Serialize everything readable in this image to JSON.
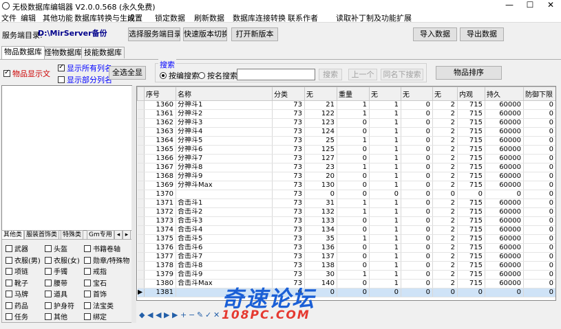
{
  "window": {
    "title": "无极数据库编辑器 V2.0.0.568 (永久免费)",
    "controls": [
      "—",
      "☐",
      "✕"
    ]
  },
  "menu": [
    "文件",
    "编辑",
    "其他功能",
    "数据库转换与生成",
    "设置",
    "锁定数据",
    "刷新数据",
    "数据库连接转换",
    "联系作者",
    "读取补丁制及功能扩展"
  ],
  "server": {
    "label": "服务端目录:",
    "path": "D:\\MirServer备份",
    "browse_btn": "选择服务端目录",
    "quick_switch_btn": "快速版本切换",
    "open_new_btn": "打开新版本"
  },
  "toolbar": {
    "import_btn": "导入数据",
    "export_btn": "导出数据"
  },
  "db_tabs": [
    "物品数据库",
    "怪物数据库",
    "技能数据库"
  ],
  "options": {
    "sync_text": "物品显示文",
    "show_all_cols": "显示所有列名",
    "show_spec_cols": "显示部分列名",
    "select_all_btn": "全选全显"
  },
  "search": {
    "group_label": "搜索",
    "mode_exact": "按编搜索",
    "mode_fuzzy": "按名搜索",
    "value": "",
    "search_btn": "搜索",
    "prev_btn": "上一个",
    "next_btn": "同名下搜索"
  },
  "sort_btn": "物品排序",
  "table": {
    "columns": [
      "序号",
      "名称",
      "分类",
      "无",
      "重量",
      "无",
      "无",
      "无",
      "内观",
      "持久",
      "防御下限"
    ],
    "rows": [
      [
        "1360",
        "分神斗1",
        "73",
        "21",
        "1",
        "1",
        "0",
        "2",
        "715",
        "60000",
        "0"
      ],
      [
        "1361",
        "分神斗2",
        "73",
        "122",
        "1",
        "1",
        "0",
        "2",
        "715",
        "60000",
        "0"
      ],
      [
        "1362",
        "分神斗3",
        "73",
        "123",
        "0",
        "1",
        "0",
        "2",
        "715",
        "60000",
        "0"
      ],
      [
        "1363",
        "分神斗4",
        "73",
        "124",
        "0",
        "1",
        "0",
        "2",
        "715",
        "60000",
        "0"
      ],
      [
        "1364",
        "分神斗5",
        "73",
        "25",
        "1",
        "1",
        "0",
        "2",
        "715",
        "60000",
        "0"
      ],
      [
        "1365",
        "分神斗6",
        "73",
        "125",
        "0",
        "1",
        "0",
        "2",
        "715",
        "60000",
        "0"
      ],
      [
        "1366",
        "分神斗7",
        "73",
        "127",
        "0",
        "1",
        "0",
        "2",
        "715",
        "60000",
        "0"
      ],
      [
        "1367",
        "分神斗8",
        "73",
        "23",
        "1",
        "1",
        "0",
        "2",
        "715",
        "60000",
        "0"
      ],
      [
        "1368",
        "分神斗9",
        "73",
        "20",
        "0",
        "1",
        "0",
        "2",
        "715",
        "60000",
        "0"
      ],
      [
        "1369",
        "分神斗Max",
        "73",
        "130",
        "0",
        "1",
        "0",
        "2",
        "715",
        "60000",
        "0"
      ],
      [
        "1370",
        "",
        "73",
        "0",
        "0",
        "0",
        "0",
        "0",
        "0",
        "0",
        "0"
      ],
      [
        "1371",
        "合击斗1",
        "73",
        "31",
        "1",
        "1",
        "0",
        "2",
        "715",
        "60000",
        "0"
      ],
      [
        "1372",
        "合击斗2",
        "73",
        "132",
        "1",
        "1",
        "0",
        "2",
        "715",
        "60000",
        "0"
      ],
      [
        "1373",
        "合击斗3",
        "73",
        "133",
        "0",
        "1",
        "0",
        "2",
        "715",
        "60000",
        "0"
      ],
      [
        "1374",
        "合击斗4",
        "73",
        "134",
        "0",
        "1",
        "0",
        "2",
        "715",
        "60000",
        "0"
      ],
      [
        "1375",
        "合击斗5",
        "73",
        "35",
        "1",
        "1",
        "0",
        "2",
        "715",
        "60000",
        "0"
      ],
      [
        "1376",
        "合击斗6",
        "73",
        "136",
        "0",
        "1",
        "0",
        "2",
        "715",
        "60000",
        "0"
      ],
      [
        "1377",
        "合击斗7",
        "73",
        "137",
        "0",
        "1",
        "0",
        "2",
        "715",
        "60000",
        "0"
      ],
      [
        "1378",
        "合击斗8",
        "73",
        "138",
        "0",
        "1",
        "0",
        "2",
        "715",
        "60000",
        "0"
      ],
      [
        "1379",
        "合击斗9",
        "73",
        "30",
        "1",
        "1",
        "0",
        "2",
        "715",
        "60000",
        "0"
      ],
      [
        "1380",
        "合击斗Max",
        "73",
        "140",
        "0",
        "1",
        "0",
        "2",
        "715",
        "60000",
        "0"
      ],
      [
        "1381",
        "",
        "0",
        "0",
        "0",
        "0",
        "0",
        "0",
        "0",
        "0",
        "0"
      ]
    ],
    "selected_index": 21
  },
  "category_tabs": [
    "其他类",
    "服装首饰类",
    "特殊类",
    "Gm专用"
  ],
  "category_checks": [
    [
      "武器",
      "头盔",
      "书籍卷轴"
    ],
    [
      "衣服(男)",
      "衣服(女)",
      "勋章/特殊物"
    ],
    [
      "项链",
      "手镯",
      "戒指"
    ],
    [
      "靴子",
      "腰带",
      "宝石"
    ],
    [
      "马牌",
      "道具",
      "首饰"
    ],
    [
      "药品",
      "护身符",
      "法宝类"
    ],
    [
      "任务",
      "其他",
      "绑定"
    ]
  ],
  "nav": [
    "◆",
    "◀",
    "◀",
    "▶",
    "▶",
    "+",
    "−",
    "✎",
    "✓",
    "✕"
  ],
  "watermark": {
    "zh": "奇速论坛",
    "en": "108PC.COM"
  }
}
